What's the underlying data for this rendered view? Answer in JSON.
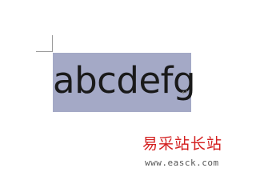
{
  "document": {
    "text": "abcdefg",
    "paragraph_mark": "↵",
    "selected": true
  },
  "watermark": {
    "title": "易采站长站",
    "url": "www.easck.com"
  },
  "colors": {
    "selection": "#a4a9c6",
    "text": "#1a1a1a",
    "watermark_title": "#d42020"
  }
}
